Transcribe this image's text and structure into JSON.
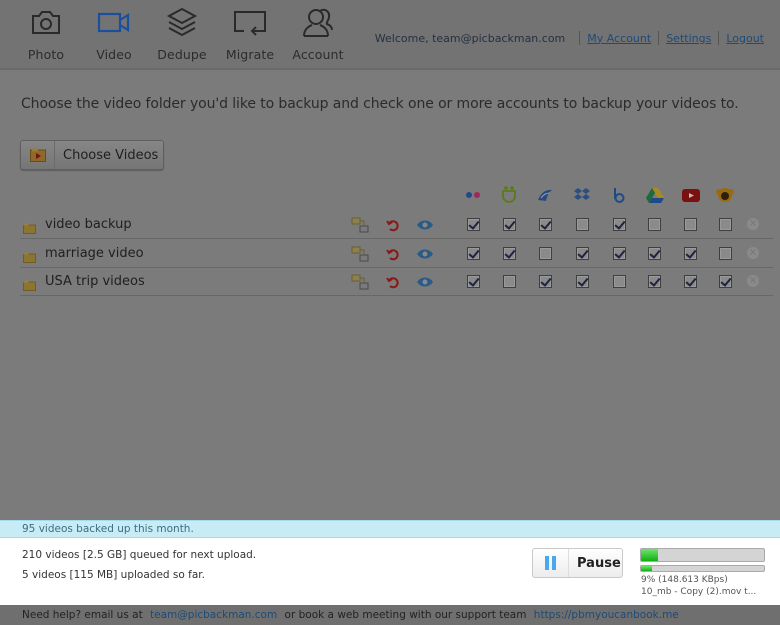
{
  "nav": {
    "items": [
      {
        "label": "Photo",
        "icon": "camera-icon",
        "active": false
      },
      {
        "label": "Video",
        "icon": "video-camera-icon",
        "active": true
      },
      {
        "label": "Dedupe",
        "icon": "layers-icon",
        "active": false
      },
      {
        "label": "Migrate",
        "icon": "migrate-icon",
        "active": false
      },
      {
        "label": "Account",
        "icon": "users-icon",
        "active": false
      }
    ]
  },
  "topbar": {
    "welcome": "Welcome,  team@picbackman.com",
    "my_account": "My Account",
    "settings": "Settings",
    "logout": "Logout"
  },
  "main": {
    "intro": "Choose the video folder you'd like to backup and check one or more accounts to backup your videos to.",
    "choose_button": "Choose Videos"
  },
  "services": [
    {
      "name": "flickr",
      "icon": "flickr-icon"
    },
    {
      "name": "smugmug",
      "icon": "smugmug-icon"
    },
    {
      "name": "zenfolio",
      "icon": "zenfolio-icon"
    },
    {
      "name": "dropbox",
      "icon": "dropbox-icon"
    },
    {
      "name": "box",
      "icon": "box-icon"
    },
    {
      "name": "google-drive",
      "icon": "google-drive-icon"
    },
    {
      "name": "youtube",
      "icon": "youtube-icon"
    },
    {
      "name": "pic-monkey",
      "icon": "monkey-icon"
    }
  ],
  "folders": [
    {
      "name": "video backup",
      "checks": [
        true,
        true,
        true,
        false,
        true,
        false,
        false,
        false
      ]
    },
    {
      "name": "marriage video",
      "checks": [
        true,
        true,
        false,
        true,
        true,
        true,
        true,
        false
      ]
    },
    {
      "name": "USA trip videos",
      "checks": [
        true,
        false,
        true,
        true,
        false,
        true,
        true,
        true
      ]
    }
  ],
  "status": {
    "month_summary": "95 videos backed up this month.",
    "queued": "210 videos [2.5 GB] queued for next upload.",
    "uploaded": "5 videos [115 MB] uploaded so far.",
    "pause_label": "Pause",
    "overall_progress": 0.14,
    "file_progress": 0.09,
    "speed": "9% (148.613 KBps)",
    "current_file": "10_mb - Copy (2).mov t..."
  },
  "footer": {
    "text1": "Need help? email us at",
    "email": "team@picbackman.com",
    "text2": "or book a web meeting with our support team",
    "link": "https://pbmyoucanbook.me"
  },
  "colors": {
    "accent": "#1a4fa0",
    "status_strip": "#c7ecf6",
    "progress_green": "#10b010"
  }
}
